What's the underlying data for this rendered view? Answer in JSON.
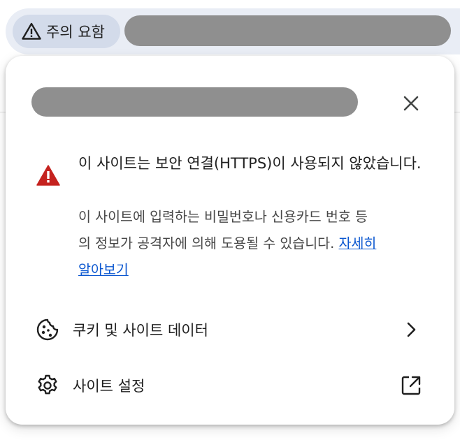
{
  "toolbar": {
    "security_chip": {
      "icon": "warning-triangle-icon",
      "label": "주의 요함"
    }
  },
  "popup": {
    "close_icon": "close-icon",
    "warning": {
      "icon": "warning-triangle-filled-icon",
      "icon_color": "#c5221f",
      "heading": "이 사이트는 보안 연결(HTTPS)이 사용되지 않았습니다.",
      "body_line1": "이 사이트에 입력하는 비밀번호나 신용카드 번호 등",
      "body_line2": "의 정보가 공격자에 의해 도용될 수 있습니다.",
      "learn_more_line1": "자세히",
      "learn_more_line2": "알아보기",
      "link_color": "#0b57d0"
    },
    "rows": [
      {
        "icon": "cookie-icon",
        "label": "쿠키 및 사이트 데이터",
        "trailing_icon": "chevron-right-icon"
      },
      {
        "icon": "gear-icon",
        "label": "사이트 설정",
        "trailing_icon": "open-in-new-icon"
      }
    ]
  }
}
